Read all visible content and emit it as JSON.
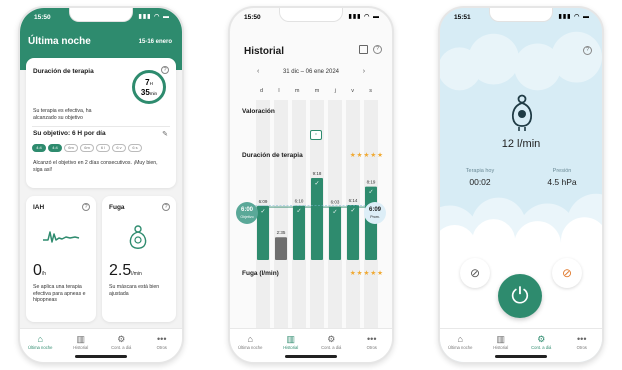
{
  "colors": {
    "brand": "#2e8b6e",
    "star": "#f0a830",
    "sky": "#d7ecf5",
    "mask_orange": "#e07a2e"
  },
  "phone1": {
    "status_time": "15:50",
    "header_title": "Última noche",
    "header_date": "15-16 enero",
    "therapy": {
      "title": "Duración de terapia",
      "hours": "7",
      "hours_unit": "H",
      "minutes": "35",
      "minutes_unit": "min",
      "message": "Su terapia es efectiva, ha alcanzado su objetivo"
    },
    "goal": {
      "title": "Su objetivo: 6 H por día",
      "days": [
        "4:4",
        "4:4",
        "6m",
        "6m",
        "6 l",
        "6 v",
        "6 s"
      ],
      "done_count": 2,
      "message": "Alcanzó el objetivo en 2 días consecutivos. ¡Muy bien, siga así!"
    },
    "iah": {
      "title": "IAH",
      "value": "0",
      "unit": "/h",
      "message": "Se aplica una terapia efectiva para apneas e hipopneas"
    },
    "leak": {
      "title": "Fuga",
      "value": "2.5",
      "unit": "l/min",
      "message": "Su máscara está bien ajustada"
    }
  },
  "tabs": [
    {
      "label": "Última noche",
      "icon": "bed-icon"
    },
    {
      "label": "Historial",
      "icon": "bar-chart-icon"
    },
    {
      "label": "Cont. a diá",
      "icon": "gear-icon"
    },
    {
      "label": "Otros",
      "icon": "more-icon"
    }
  ],
  "phone2": {
    "status_time": "15:50",
    "title": "Historial",
    "range": "31 dic – 06 ene 2024",
    "weekdays": [
      "d",
      "l",
      "m",
      "m",
      "j",
      "v",
      "s"
    ],
    "section_rating": "Valoración",
    "section_duration": "Duración de terapia",
    "section_leak": "Fuga (l/min)",
    "stars": "★★★★★",
    "objective_tag": "6:00",
    "objective_sub": "Objetivo",
    "average_tag": "6:09",
    "average_sub": "Prom."
  },
  "chart_data": {
    "type": "bar",
    "title": "Duración de terapia",
    "categories": [
      "d",
      "l",
      "m",
      "m",
      "j",
      "v",
      "s"
    ],
    "values_hours": [
      6.15,
      2.58,
      6.17,
      9.3,
      6.05,
      6.23,
      8.32
    ],
    "data_labels": [
      "6:09",
      "2:35",
      "6:10",
      "9:18",
      "6:03",
      "6:14",
      "8:19"
    ],
    "goal_met": [
      true,
      false,
      true,
      true,
      true,
      true,
      true
    ],
    "objective": 6.0,
    "average": 6.15,
    "ylim": [
      0,
      10
    ]
  },
  "phone3": {
    "status_time": "15:51",
    "flow": "12 l/min",
    "therapy_today_label": "Terapia hoy",
    "therapy_today_value": "00:02",
    "pressure_label": "Presión",
    "pressure_value": "4.5 hPa"
  }
}
